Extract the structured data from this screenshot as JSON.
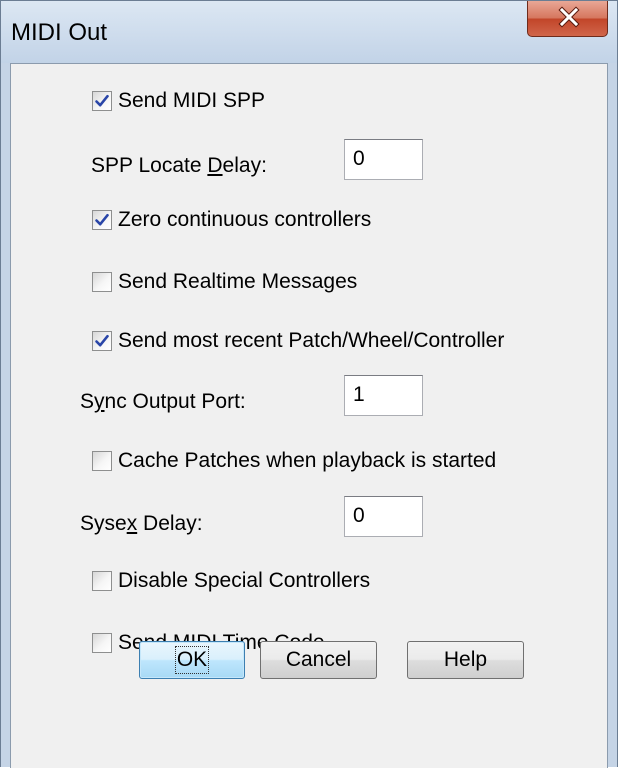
{
  "window": {
    "title": "MIDI Out"
  },
  "options": {
    "send_midi_spp": {
      "label": "Send MIDI SPP",
      "checked": true
    },
    "zero_continuous_controllers": {
      "label": "Zero continuous controllers",
      "checked": true
    },
    "send_realtime_messages": {
      "label": "Send Realtime Messages",
      "checked": false
    },
    "send_most_recent": {
      "label": "Send most recent Patch/Wheel/Controller",
      "checked": true
    },
    "cache_patches": {
      "label": "Cache Patches when playback is started",
      "checked": false
    },
    "disable_special_controllers": {
      "label": "Disable Special Controllers",
      "checked": false
    },
    "send_midi_time_code": {
      "label": "Send MIDI Time Code",
      "checked": false
    }
  },
  "fields": {
    "spp_locate_delay": {
      "label_pre": "SPP Locate ",
      "label_mnemonic": "D",
      "label_post": "elay:",
      "value": "0"
    },
    "sync_output_port": {
      "label_pre": "S",
      "label_mnemonic": "y",
      "label_post": "nc Output Port:",
      "value": "1"
    },
    "sysex_delay": {
      "label_pre": "Syse",
      "label_mnemonic": "x",
      "label_post": " Delay:",
      "value": "0"
    }
  },
  "buttons": {
    "ok": "OK",
    "cancel": "Cancel",
    "help": "Help"
  },
  "colors": {
    "checkmark": "#2a46a8",
    "default_button_border": "#3c7fb1",
    "close_button": "#c2452a"
  }
}
